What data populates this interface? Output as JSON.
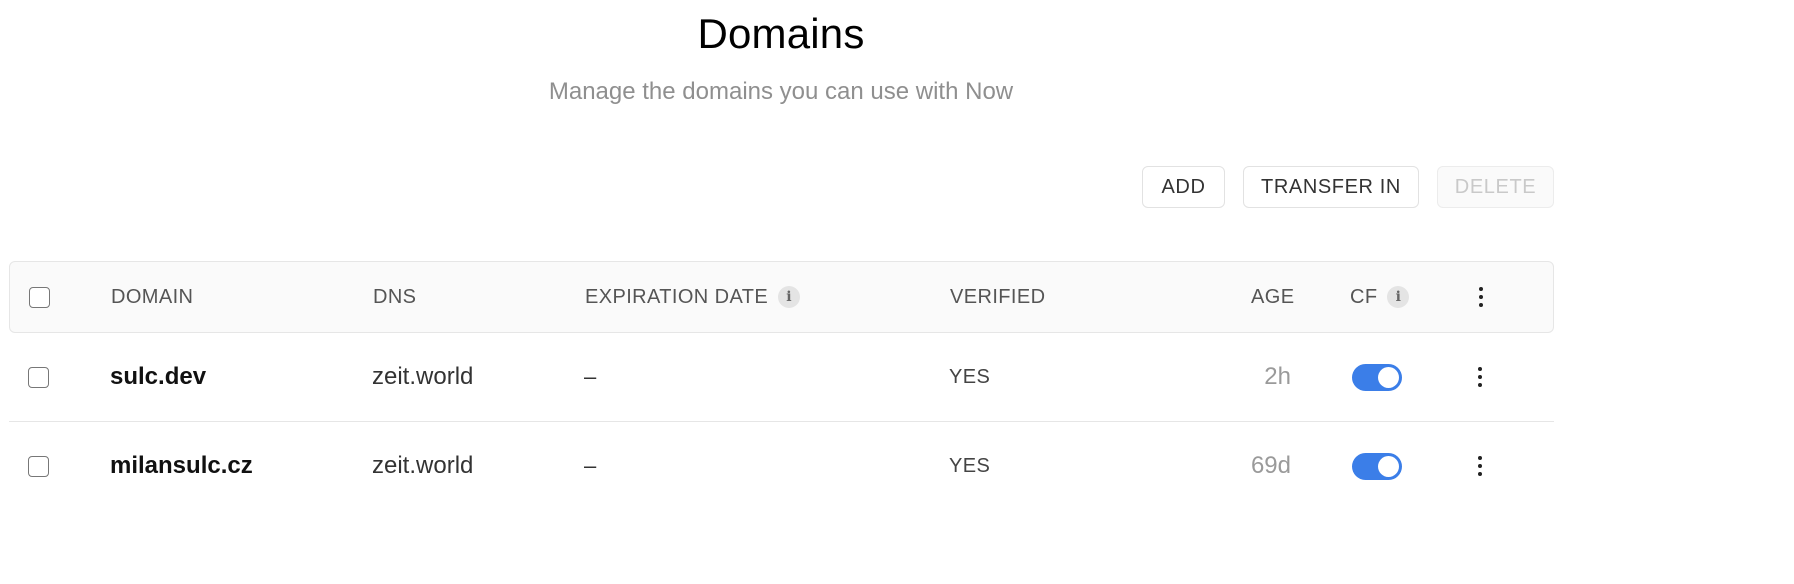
{
  "header": {
    "title": "Domains",
    "subtitle": "Manage the domains you can use with Now"
  },
  "toolbar": {
    "add_label": "ADD",
    "transfer_label": "TRANSFER IN",
    "delete_label": "DELETE"
  },
  "table": {
    "columns": {
      "domain": "DOMAIN",
      "dns": "DNS",
      "expiration": "EXPIRATION DATE",
      "verified": "VERIFIED",
      "age": "AGE",
      "cf": "CF"
    },
    "info_glyph": "i",
    "rows": [
      {
        "domain": "sulc.dev",
        "dns": "zeit.world",
        "expiration": "–",
        "verified": "YES",
        "age": "2h",
        "cf_enabled": true
      },
      {
        "domain": "milansulc.cz",
        "dns": "zeit.world",
        "expiration": "–",
        "verified": "YES",
        "age": "69d",
        "cf_enabled": true
      }
    ]
  },
  "colors": {
    "toggle_on": "#3b7ee8",
    "subtitle": "#8f8f8f",
    "age_text": "#9a9a9a"
  },
  "icons": {
    "info": "info-icon",
    "more": "kebab-icon"
  }
}
